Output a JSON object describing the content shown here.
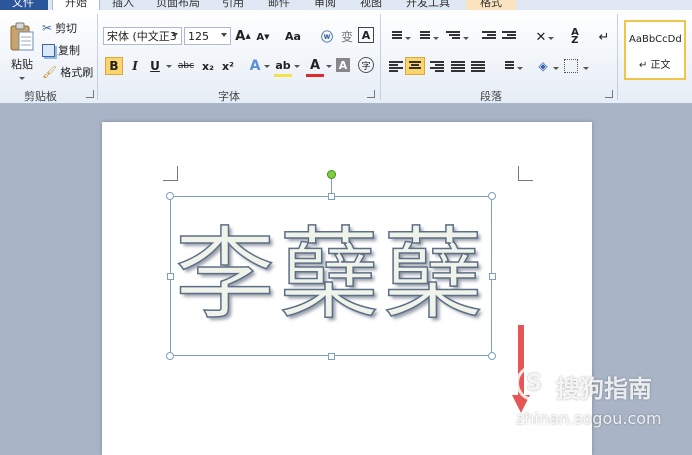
{
  "tabs": {
    "file": "文件",
    "home": "开始",
    "insert": "插入",
    "page_layout": "页面布局",
    "references": "引用",
    "mailings": "邮件",
    "review": "审阅",
    "view": "视图",
    "developer": "开发工具",
    "format": "格式"
  },
  "clipboard": {
    "paste": "粘贴",
    "cut": "剪切",
    "copy": "复制",
    "format_painter": "格式刷",
    "group_label": "剪贴板"
  },
  "font": {
    "font_name": "宋体 (中文正3",
    "font_size": "125",
    "grow": "A",
    "shrink": "A",
    "change_case": "Aa",
    "bold": "B",
    "italic": "I",
    "underline": "U",
    "strikethrough": "abc",
    "subscript": "x₂",
    "superscript": "x²",
    "group_label": "字体"
  },
  "paragraph": {
    "group_label": "段落"
  },
  "styles": {
    "preview": "AaBbCcDd",
    "name": "↵ 正文"
  },
  "document": {
    "wordart_text": "李蘖蘖"
  },
  "watermark": {
    "logo": "S",
    "brand": "搜狗指南",
    "url": "zhinan.sogou.com"
  },
  "colors": {
    "accent_file_tab": "#2b579a",
    "format_tab": "#fbe3c0",
    "arrow_red": "#e03a3a"
  }
}
